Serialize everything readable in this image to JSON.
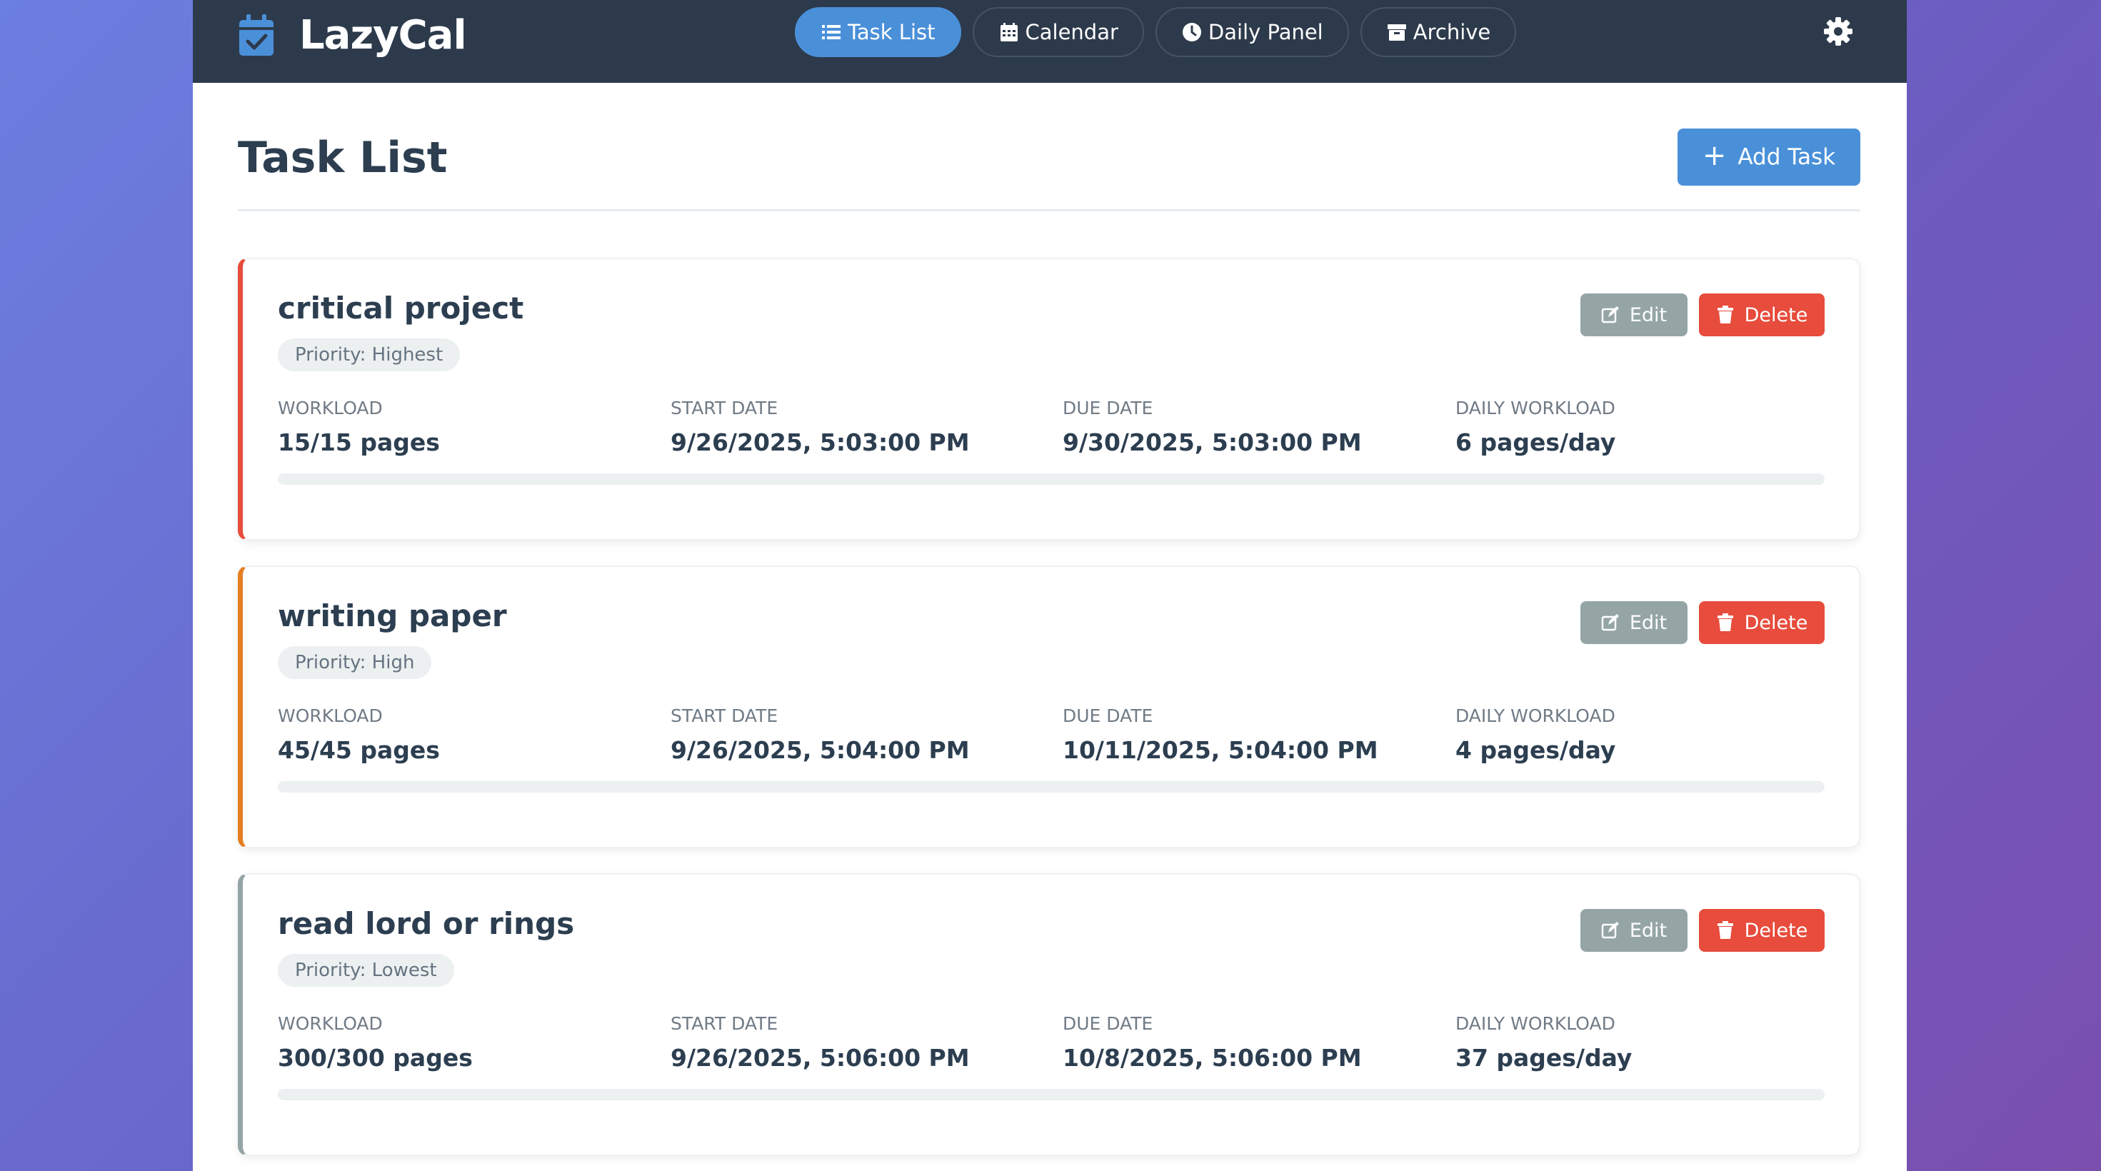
{
  "app": {
    "name": "LazyCal"
  },
  "nav": {
    "tabs": [
      {
        "label": "Task List",
        "icon": "list-icon",
        "active": true
      },
      {
        "label": "Calendar",
        "icon": "calendar-icon",
        "active": false
      },
      {
        "label": "Daily Panel",
        "icon": "clock-icon",
        "active": false
      },
      {
        "label": "Archive",
        "icon": "archive-icon",
        "active": false
      }
    ]
  },
  "page": {
    "title": "Task List",
    "add_button": "Add Task"
  },
  "fields_labels": {
    "workload": "Workload",
    "start_date": "Start Date",
    "due_date": "Due Date",
    "daily_workload": "Daily Workload"
  },
  "buttons": {
    "edit": "Edit",
    "delete": "Delete"
  },
  "tasks": [
    {
      "name": "critical project",
      "priority": "Priority: Highest",
      "workload": "15/15 pages",
      "start_date": "9/26/2025, 5:03:00 PM",
      "due_date": "9/30/2025, 5:03:00 PM",
      "daily_workload": "6 pages/day",
      "progress": 0
    },
    {
      "name": "writing paper",
      "priority": "Priority: High",
      "workload": "45/45 pages",
      "start_date": "9/26/2025, 5:04:00 PM",
      "due_date": "10/11/2025, 5:04:00 PM",
      "daily_workload": "4 pages/day",
      "progress": 0
    },
    {
      "name": "read lord or rings",
      "priority": "Priority: Lowest",
      "workload": "300/300 pages",
      "start_date": "9/26/2025, 5:06:00 PM",
      "due_date": "10/8/2025, 5:06:00 PM",
      "daily_workload": "37 pages/day",
      "progress": 0
    }
  ],
  "colors": {
    "accent": "#4a90d9",
    "topbar": "#2d3a4b",
    "priority_highest": "#e74c3c",
    "priority_high": "#e67e22",
    "priority_lowest": "#95a5a6",
    "delete": "#e74c3c",
    "edit": "#95a5a6"
  }
}
